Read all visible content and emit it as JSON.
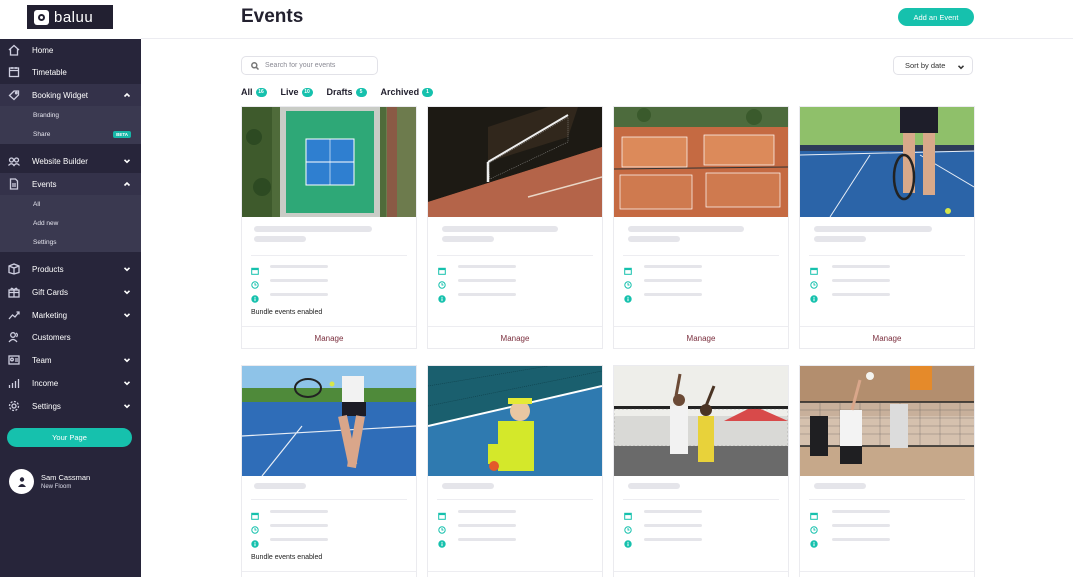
{
  "brand": {
    "name": "baluu",
    "accent": "#16c1ad",
    "sidebar_bg": "#27253a"
  },
  "header": {
    "title": "Events",
    "add_button": "Add an Event"
  },
  "sidebar": {
    "items": [
      {
        "label": "Home",
        "icon": "home-icon"
      },
      {
        "label": "Timetable",
        "icon": "calendar-icon"
      },
      {
        "label": "Booking Widget",
        "icon": "tag-icon"
      },
      {
        "label": "Website Builder",
        "icon": "users-icon"
      },
      {
        "label": "Events",
        "icon": "document-icon"
      },
      {
        "label": "Products",
        "icon": "box-icon"
      },
      {
        "label": "Gift Cards",
        "icon": "gift-icon"
      },
      {
        "label": "Marketing",
        "icon": "trend-icon"
      },
      {
        "label": "Customers",
        "icon": "customers-icon"
      },
      {
        "label": "Team",
        "icon": "team-icon"
      },
      {
        "label": "Income",
        "icon": "bar-chart-icon"
      },
      {
        "label": "Settings",
        "icon": "gear-icon"
      }
    ],
    "booking_sub": [
      {
        "label": "Branding"
      },
      {
        "label": "Share",
        "badge": "BETA"
      }
    ],
    "events_sub": [
      {
        "label": "All"
      },
      {
        "label": "Add new"
      },
      {
        "label": "Settings"
      }
    ],
    "your_page": "Your Page",
    "user": {
      "name": "Sam Cassman",
      "location": "New Floom"
    }
  },
  "toolbar": {
    "search_placeholder": "Search for your events",
    "sort_label": "Sort by date"
  },
  "tabs": [
    {
      "label": "All",
      "count": "16"
    },
    {
      "label": "Live",
      "count": "10"
    },
    {
      "label": "Drafts",
      "count": "5"
    },
    {
      "label": "Archived",
      "count": "1"
    }
  ],
  "cards": [
    {
      "image": "aerial tennis court",
      "bundle": "Bundle events enabled",
      "manage": "Manage"
    },
    {
      "image": "tennis net on clay court",
      "bundle": "",
      "manage": "Manage"
    },
    {
      "image": "aerial clay courts with players",
      "bundle": "",
      "manage": "Manage"
    },
    {
      "image": "tennis player legs with racket",
      "bundle": "",
      "manage": "Manage"
    },
    {
      "image": "woman hitting tennis ball",
      "bundle": "Bundle events enabled",
      "manage": ""
    },
    {
      "image": "tennis player resting with drink",
      "bundle": "",
      "manage": ""
    },
    {
      "image": "volleyball players at net",
      "bundle": "",
      "manage": ""
    },
    {
      "image": "indoor volleyball block",
      "bundle": "",
      "manage": ""
    }
  ]
}
